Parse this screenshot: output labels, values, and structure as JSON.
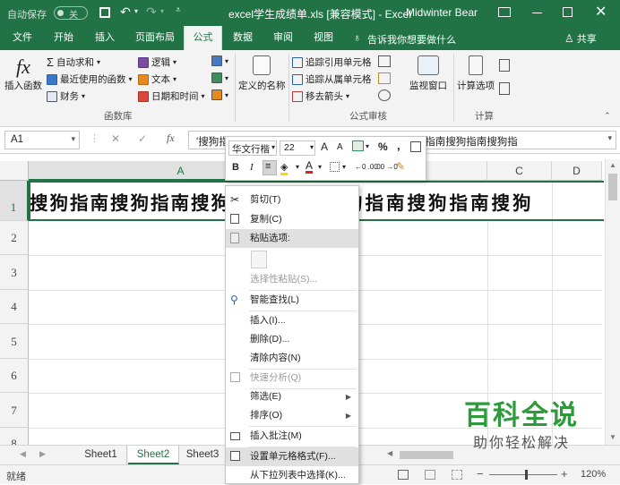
{
  "titlebar": {
    "autosave_label": "自动保存",
    "autosave_state": "关",
    "title": "excel学生成绩单.xls  [兼容模式]  -  Excel",
    "user": "Midwinter Bear"
  },
  "tabs": [
    "文件",
    "开始",
    "插入",
    "页面布局",
    "公式",
    "数据",
    "审阅",
    "视图"
  ],
  "active_tab": "公式",
  "tell_me": "告诉我你想要做什么",
  "share": "共享",
  "ribbon": {
    "insert_function": "插入函数",
    "autosum": "自动求和",
    "recent": "最近使用的函数",
    "finance": "财务",
    "logic": "逻辑",
    "text": "文本",
    "datetime": "日期和时间",
    "define_name": "定义的名称",
    "trace_precedents": "追踪引用单元格",
    "trace_dependents": "追踪从属单元格",
    "remove_arrows": "移去箭头",
    "watch_window": "监视窗口",
    "calc_options": "计算选项",
    "group_library": "函数库",
    "group_audit": "公式审核",
    "group_calc": "计算"
  },
  "formula_bar": {
    "name_box": "A1",
    "fx": "fx",
    "content": "'搜狗指南搜狗指南搜狗指南搜狗指南搜狗指南搜狗指南搜狗指南搜狗指"
  },
  "columns": [
    "A",
    "C",
    "D"
  ],
  "rows": [
    "1",
    "2",
    "3",
    "4",
    "5",
    "6",
    "7",
    "8"
  ],
  "cell_a1_left": "搜狗指南搜狗指南搜狗指",
  "cell_a1_right": "狗指南搜狗指南搜狗",
  "mini_toolbar": {
    "font": "华文行楷",
    "size": "22",
    "grow": "A",
    "shrink": "A",
    "percent": "%",
    "comma": ",",
    "bold": "B",
    "italic": "I",
    "font_color": "A",
    "dec_inc": "←0 .00",
    "dec_dec": ".00 →0"
  },
  "context_menu": {
    "cut": "剪切(T)",
    "copy": "复制(C)",
    "paste_options": "粘贴选项:",
    "paste_special": "选择性粘贴(S)...",
    "smart_lookup": "智能查找(L)",
    "insert": "插入(I)...",
    "delete": "删除(D)...",
    "clear": "清除内容(N)",
    "quick_analysis": "快速分析(Q)",
    "filter": "筛选(E)",
    "sort": "排序(O)",
    "insert_comment": "插入批注(M)",
    "format_cells": "设置单元格格式(F)...",
    "pick_list": "从下拉列表中选择(K)..."
  },
  "sheets": [
    "Sheet1",
    "Sheet2",
    "Sheet3"
  ],
  "active_sheet": "Sheet2",
  "status": {
    "ready": "就绪",
    "zoom": "120%"
  },
  "watermark": {
    "title": "百科全说",
    "subtitle": "助你轻松解决"
  },
  "colors": {
    "excel_green": "#217346",
    "ribbon_bg": "#f3f3f3",
    "watermark_green": "#2e9a3c"
  }
}
